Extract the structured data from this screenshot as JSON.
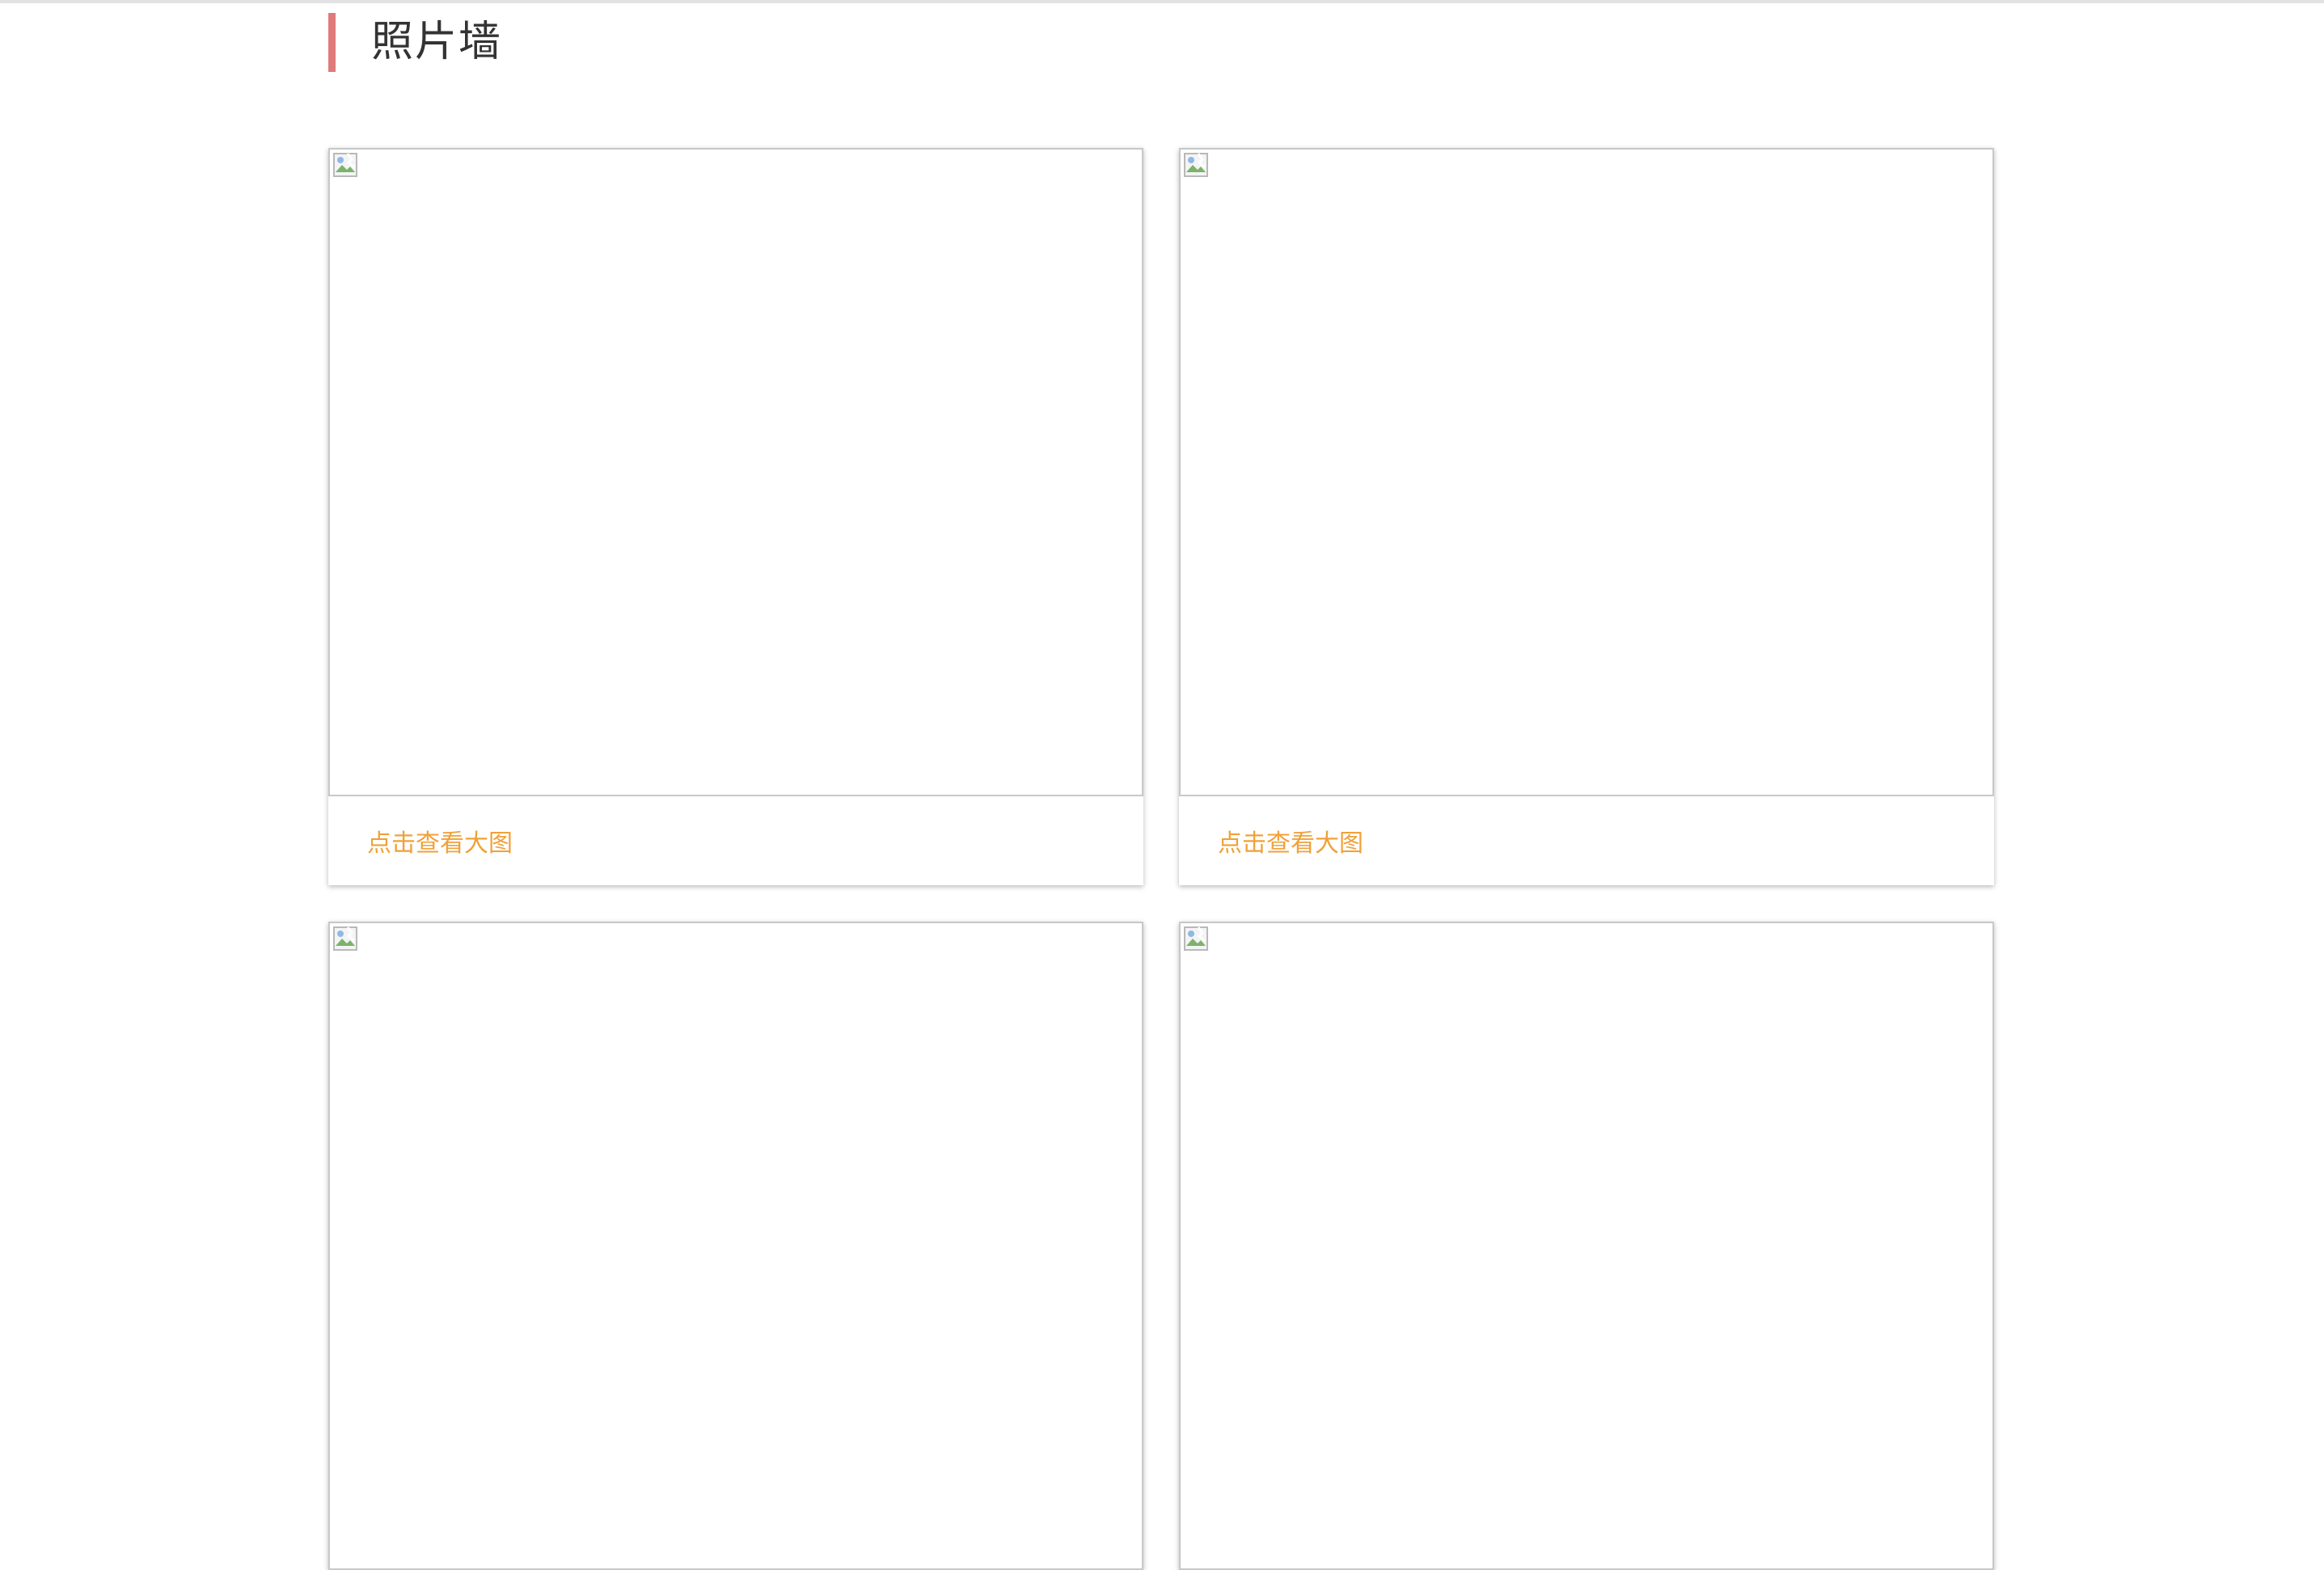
{
  "header": {
    "title": "照片墙",
    "accent_color": "#e07a7a"
  },
  "gallery": {
    "link_color": "#f0a13a",
    "cards": [
      {
        "caption": "点击查看大图",
        "image_icon": "broken-image-icon"
      },
      {
        "caption": "点击查看大图",
        "image_icon": "broken-image-icon"
      },
      {
        "caption": "",
        "image_icon": "broken-image-icon"
      },
      {
        "caption": "",
        "image_icon": "broken-image-icon"
      }
    ]
  }
}
